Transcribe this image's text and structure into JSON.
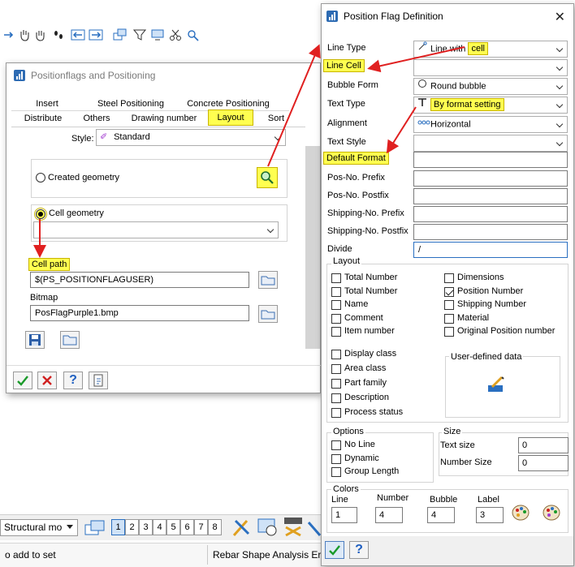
{
  "status_bar": {
    "left_text": "o add to set",
    "right_text": "Rebar Shape Analysis Er",
    "model_combo": "Structural mo",
    "view_buttons": [
      "1",
      "2",
      "3",
      "4",
      "5",
      "6",
      "7",
      "8"
    ]
  },
  "pp_dialog": {
    "title": "Positionflags and Positioning",
    "tabs_row1": [
      "Insert",
      "Steel Positioning",
      "Concrete Positioning"
    ],
    "tabs_row2": [
      "Distribute",
      "Others",
      "Drawing number",
      "Layout",
      "Sort"
    ],
    "style_label": "Style:",
    "style_value": "Standard",
    "created_geometry_label": "Created geometry",
    "cell_geometry_label": "Cell geometry",
    "cell_geometry_value": "",
    "cell_path_label": "Cell path",
    "cell_path_value": "$(PS_POSITIONFLAGUSER)",
    "bitmap_label": "Bitmap",
    "bitmap_value": "PosFlagPurple1.bmp"
  },
  "pfd": {
    "title": "Position Flag Definition",
    "rows": [
      {
        "label": "Line Type",
        "value": "Line with ",
        "value_hl": "cell",
        "type": "combo",
        "icon": "line-cell-icon",
        "label_hl": false
      },
      {
        "label": "Line Cell",
        "value": "",
        "value_hl": "",
        "type": "combo",
        "icon": "",
        "label_hl": true
      },
      {
        "label": "Bubble Form",
        "value": "Round bubble",
        "value_hl": "",
        "type": "combo",
        "icon": "circle-icon",
        "label_hl": false
      },
      {
        "label": "Text Type",
        "value": "By format setting",
        "value_hl": "",
        "type": "combo",
        "icon": "text-t-icon",
        "label_hl": false,
        "value_is_hl": true
      },
      {
        "label": "Alignment",
        "value": "Horizontal",
        "value_hl": "",
        "type": "combo",
        "icon": "dots-icon",
        "label_hl": false
      },
      {
        "label": "Text Style",
        "value": "",
        "value_hl": "",
        "type": "combo",
        "icon": "",
        "label_hl": false
      },
      {
        "label": "Default Format",
        "value": "",
        "value_hl": "",
        "type": "field",
        "icon": "",
        "label_hl": true
      },
      {
        "label": "Pos-No. Prefix",
        "value": "",
        "value_hl": "",
        "type": "field",
        "icon": "",
        "label_hl": false
      },
      {
        "label": "Pos-No. Postfix",
        "value": "",
        "value_hl": "",
        "type": "field",
        "icon": "",
        "label_hl": false
      },
      {
        "label": "Shipping-No. Prefix",
        "value": "",
        "value_hl": "",
        "type": "field",
        "icon": "",
        "label_hl": false
      },
      {
        "label": "Shipping-No. Postfix",
        "value": "",
        "value_hl": "",
        "type": "field",
        "icon": "",
        "label_hl": false
      },
      {
        "label": "Divide",
        "value": "/",
        "value_hl": "",
        "type": "field",
        "icon": "",
        "label_hl": false
      }
    ],
    "layout_title": "Layout",
    "layout_left": [
      {
        "label": "Total Number",
        "checked": false
      },
      {
        "label": "Total Number",
        "checked": false
      },
      {
        "label": "Name",
        "checked": false
      },
      {
        "label": "Comment",
        "checked": false
      },
      {
        "label": "Item number",
        "checked": false
      }
    ],
    "layout_right": [
      {
        "label": "Dimensions",
        "checked": false
      },
      {
        "label": "Position Number",
        "checked": true
      },
      {
        "label": "Shipping Number",
        "checked": false
      },
      {
        "label": "Material",
        "checked": false
      },
      {
        "label": "Original Position number",
        "checked": false
      }
    ],
    "layout_left2": [
      {
        "label": "Display class",
        "checked": false
      },
      {
        "label": "Area class",
        "checked": false
      },
      {
        "label": "Part family",
        "checked": false
      },
      {
        "label": "Description",
        "checked": false
      },
      {
        "label": "Process status",
        "checked": false
      }
    ],
    "user_defined_label": "User-defined data",
    "options_title": "Options",
    "options": [
      {
        "label": "No Line",
        "checked": false
      },
      {
        "label": "Dynamic",
        "checked": false
      },
      {
        "label": "Group Length",
        "checked": false
      }
    ],
    "size_title": "Size",
    "text_size_label": "Text size",
    "text_size_value": "0",
    "number_size_label": "Number Size",
    "number_size_value": "0",
    "colors_title": "Colors",
    "color_fields": [
      {
        "label": "Line",
        "value": "1"
      },
      {
        "label": "Number",
        "value": "4"
      },
      {
        "label": "Bubble",
        "value": "4"
      },
      {
        "label": "Label",
        "value": "3"
      }
    ]
  },
  "colors": {
    "highlight": "#ffff50",
    "arrow": "#e02020",
    "app_blue": "#2d6bb3"
  }
}
